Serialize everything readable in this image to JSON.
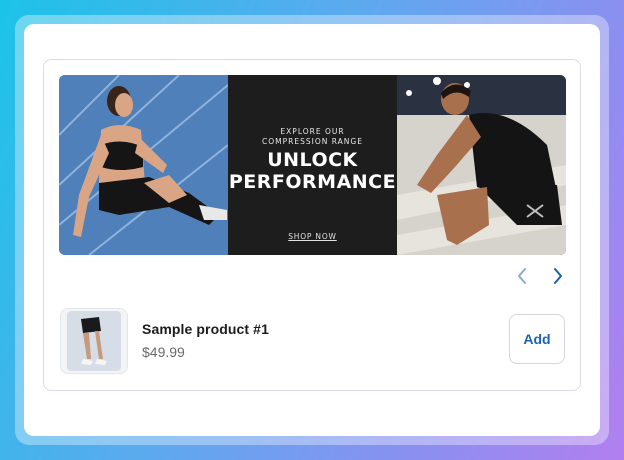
{
  "banner": {
    "kicker_line1": "EXPLORE OUR",
    "kicker_line2": "COMPRESSION RANGE",
    "headline_line1": "UNLOCK",
    "headline_line2": "PERFORMANCE",
    "cta_label": "SHOP NOW"
  },
  "carousel": {
    "prev_icon": "chevron-left-icon",
    "next_icon": "chevron-right-icon"
  },
  "product": {
    "name": "Sample product #1",
    "price": "$49.99",
    "add_label": "Add"
  },
  "colors": {
    "accent": "#1a63b8",
    "border": "#d9dde3",
    "banner_dark": "#1d1d1d"
  }
}
